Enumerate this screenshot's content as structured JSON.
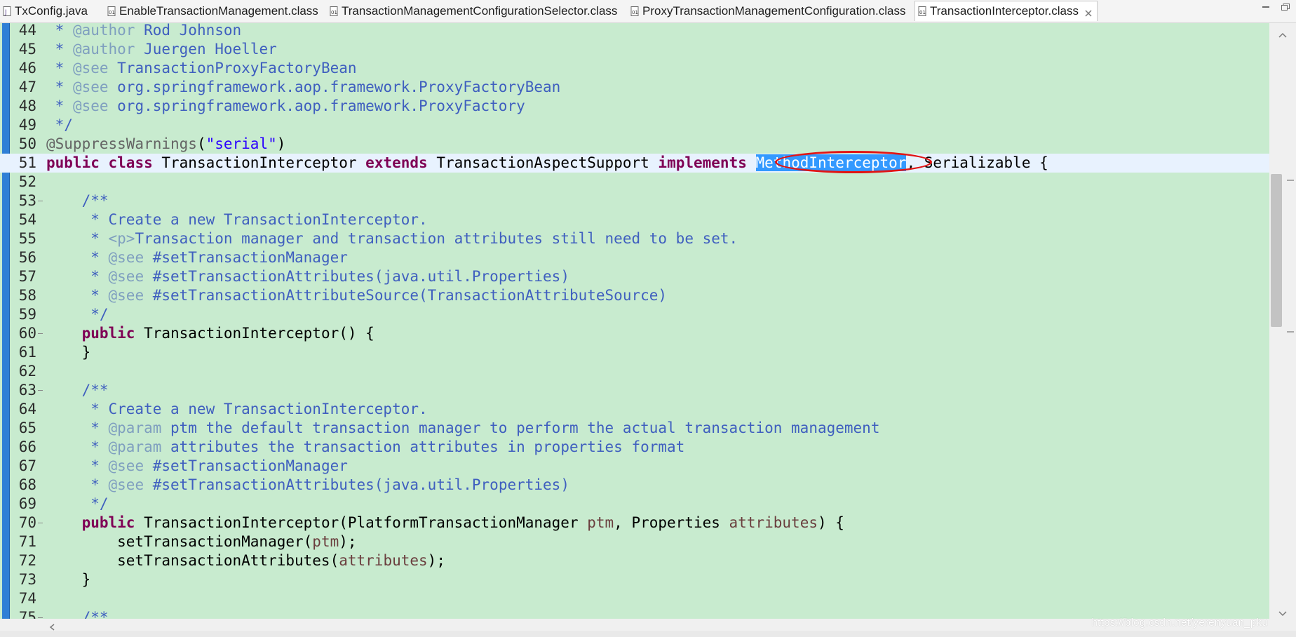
{
  "tabs": [
    {
      "label": "TxConfig.java",
      "icon": "java-file-icon",
      "active": false
    },
    {
      "label": "EnableTransactionManagement.class",
      "icon": "class-file-icon",
      "active": false
    },
    {
      "label": "TransactionManagementConfigurationSelector.class",
      "icon": "class-file-icon",
      "active": false
    },
    {
      "label": "ProxyTransactionManagementConfiguration.class",
      "icon": "class-file-icon",
      "active": false
    },
    {
      "label": "TransactionInterceptor.class",
      "icon": "class-file-icon",
      "active": true
    }
  ],
  "window_controls": [
    "minimize-icon",
    "restore-icon"
  ],
  "editor": {
    "selected_text": "MethodInterceptor",
    "current_line": "51",
    "lines": [
      {
        "n": "44",
        "fold": false,
        "parts": [
          [
            " * ",
            "cm"
          ],
          [
            "@author",
            "tag"
          ],
          [
            " Rod Johnson",
            "cm"
          ]
        ]
      },
      {
        "n": "45",
        "fold": false,
        "parts": [
          [
            " * ",
            "cm"
          ],
          [
            "@author",
            "tag"
          ],
          [
            " Juergen Hoeller",
            "cm"
          ]
        ]
      },
      {
        "n": "46",
        "fold": false,
        "parts": [
          [
            " * ",
            "cm"
          ],
          [
            "@see",
            "tag"
          ],
          [
            " TransactionProxyFactoryBean",
            "cm"
          ]
        ]
      },
      {
        "n": "47",
        "fold": false,
        "parts": [
          [
            " * ",
            "cm"
          ],
          [
            "@see",
            "tag"
          ],
          [
            " org.springframework.aop.framework.ProxyFactoryBean",
            "cm"
          ]
        ]
      },
      {
        "n": "48",
        "fold": false,
        "parts": [
          [
            " * ",
            "cm"
          ],
          [
            "@see",
            "tag"
          ],
          [
            " org.springframework.aop.framework.ProxyFactory",
            "cm"
          ]
        ]
      },
      {
        "n": "49",
        "fold": false,
        "parts": [
          [
            " */",
            "cm"
          ]
        ]
      },
      {
        "n": "50",
        "fold": false,
        "parts": [
          [
            "@SuppressWarnings",
            "ann"
          ],
          [
            "(",
            ""
          ],
          [
            "\"serial\"",
            "str"
          ],
          [
            ")",
            ""
          ]
        ]
      },
      {
        "n": "51",
        "fold": false,
        "parts": [
          [
            "public",
            "kw"
          ],
          [
            " ",
            ""
          ],
          [
            "class",
            "kw"
          ],
          [
            " TransactionInterceptor ",
            ""
          ],
          [
            "extends",
            "kw"
          ],
          [
            " TransactionAspectSupport ",
            ""
          ],
          [
            "implements",
            "kw"
          ],
          [
            " ",
            ""
          ],
          [
            "MethodInterceptor",
            "sel"
          ],
          [
            ", Serializable {",
            ""
          ]
        ]
      },
      {
        "n": "52",
        "fold": false,
        "parts": []
      },
      {
        "n": "53",
        "fold": true,
        "parts": [
          [
            "    /**",
            "cm"
          ]
        ]
      },
      {
        "n": "54",
        "fold": false,
        "parts": [
          [
            "     * Create a new TransactionInterceptor.",
            "cm"
          ]
        ]
      },
      {
        "n": "55",
        "fold": false,
        "parts": [
          [
            "     * ",
            "cm"
          ],
          [
            "<p>",
            "tag"
          ],
          [
            "Transaction manager and transaction attributes still need to be set.",
            "cm"
          ]
        ]
      },
      {
        "n": "56",
        "fold": false,
        "parts": [
          [
            "     * ",
            "cm"
          ],
          [
            "@see",
            "tag"
          ],
          [
            " #setTransactionManager",
            "cm"
          ]
        ]
      },
      {
        "n": "57",
        "fold": false,
        "parts": [
          [
            "     * ",
            "cm"
          ],
          [
            "@see",
            "tag"
          ],
          [
            " #setTransactionAttributes(java.util.Properties)",
            "cm"
          ]
        ]
      },
      {
        "n": "58",
        "fold": false,
        "parts": [
          [
            "     * ",
            "cm"
          ],
          [
            "@see",
            "tag"
          ],
          [
            " #setTransactionAttributeSource(TransactionAttributeSource)",
            "cm"
          ]
        ]
      },
      {
        "n": "59",
        "fold": false,
        "parts": [
          [
            "     */",
            "cm"
          ]
        ]
      },
      {
        "n": "60",
        "fold": true,
        "parts": [
          [
            "    ",
            ""
          ],
          [
            "public",
            "kw"
          ],
          [
            " TransactionInterceptor() {",
            ""
          ]
        ]
      },
      {
        "n": "61",
        "fold": false,
        "parts": [
          [
            "    }",
            ""
          ]
        ]
      },
      {
        "n": "62",
        "fold": false,
        "parts": []
      },
      {
        "n": "63",
        "fold": true,
        "parts": [
          [
            "    /**",
            "cm"
          ]
        ]
      },
      {
        "n": "64",
        "fold": false,
        "parts": [
          [
            "     * Create a new TransactionInterceptor.",
            "cm"
          ]
        ]
      },
      {
        "n": "65",
        "fold": false,
        "parts": [
          [
            "     * ",
            "cm"
          ],
          [
            "@param",
            "tag"
          ],
          [
            " ptm the default transaction manager to perform the actual transaction management",
            "cm"
          ]
        ]
      },
      {
        "n": "66",
        "fold": false,
        "parts": [
          [
            "     * ",
            "cm"
          ],
          [
            "@param",
            "tag"
          ],
          [
            " attributes the transaction attributes in properties format",
            "cm"
          ]
        ]
      },
      {
        "n": "67",
        "fold": false,
        "parts": [
          [
            "     * ",
            "cm"
          ],
          [
            "@see",
            "tag"
          ],
          [
            " #setTransactionManager",
            "cm"
          ]
        ]
      },
      {
        "n": "68",
        "fold": false,
        "parts": [
          [
            "     * ",
            "cm"
          ],
          [
            "@see",
            "tag"
          ],
          [
            " #setTransactionAttributes(java.util.Properties)",
            "cm"
          ]
        ]
      },
      {
        "n": "69",
        "fold": false,
        "parts": [
          [
            "     */",
            "cm"
          ]
        ]
      },
      {
        "n": "70",
        "fold": true,
        "parts": [
          [
            "    ",
            ""
          ],
          [
            "public",
            "kw"
          ],
          [
            " TransactionInterceptor(PlatformTransactionManager ",
            ""
          ],
          [
            "ptm",
            "param"
          ],
          [
            ", Properties ",
            ""
          ],
          [
            "attributes",
            "param"
          ],
          [
            ") {",
            ""
          ]
        ]
      },
      {
        "n": "71",
        "fold": false,
        "parts": [
          [
            "        setTransactionManager(",
            ""
          ],
          [
            "ptm",
            "param"
          ],
          [
            ");",
            ""
          ]
        ]
      },
      {
        "n": "72",
        "fold": false,
        "parts": [
          [
            "        setTransactionAttributes(",
            ""
          ],
          [
            "attributes",
            "param"
          ],
          [
            ");",
            ""
          ]
        ]
      },
      {
        "n": "73",
        "fold": false,
        "parts": [
          [
            "    }",
            ""
          ]
        ]
      },
      {
        "n": "74",
        "fold": false,
        "parts": []
      },
      {
        "n": "75",
        "fold": true,
        "parts": [
          [
            "    /**",
            "cm"
          ]
        ]
      }
    ]
  },
  "watermark": "https://blog.csdn.net/yerenyuan_pku"
}
